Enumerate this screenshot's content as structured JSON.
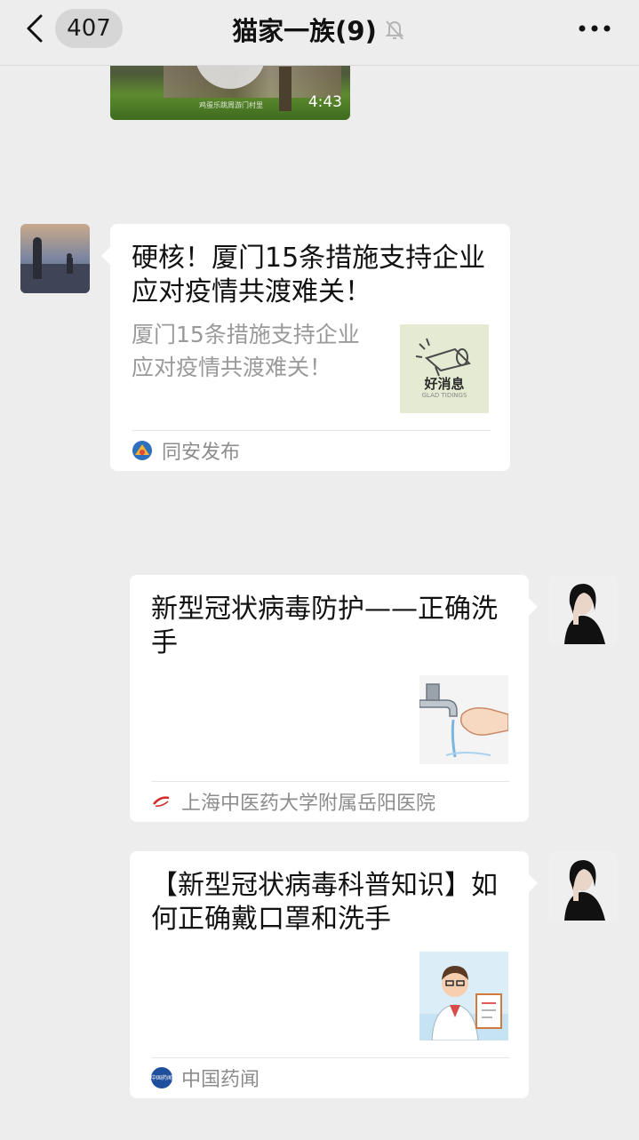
{
  "header": {
    "back_badge": "407",
    "title": "猫家一族(9)"
  },
  "video": {
    "duration": "4:43",
    "caption": "鸡蛋乐跳周游门村里"
  },
  "messages": [
    {
      "side": "left",
      "title": "硬核！厦门15条措施支持企业应对疫情共渡难关！",
      "description": "厦门15条措施支持企业应对疫情共渡难关！",
      "thumbnail_text": "好消息",
      "thumbnail_subtext": "GLAD TIDINGS",
      "source": "同安发布"
    },
    {
      "side": "right",
      "title": "新型冠状病毒防护——正确洗手",
      "source": "上海中医药大学附属岳阳医院"
    },
    {
      "side": "right",
      "title": "【新型冠状病毒科普知识】如何正确戴口罩和洗手",
      "source": "中国药闻",
      "source_icon_text": "中国药闻"
    }
  ],
  "colors": {
    "background": "#ededed",
    "bubble": "#ffffff",
    "source_text": "#8c8c8c"
  }
}
